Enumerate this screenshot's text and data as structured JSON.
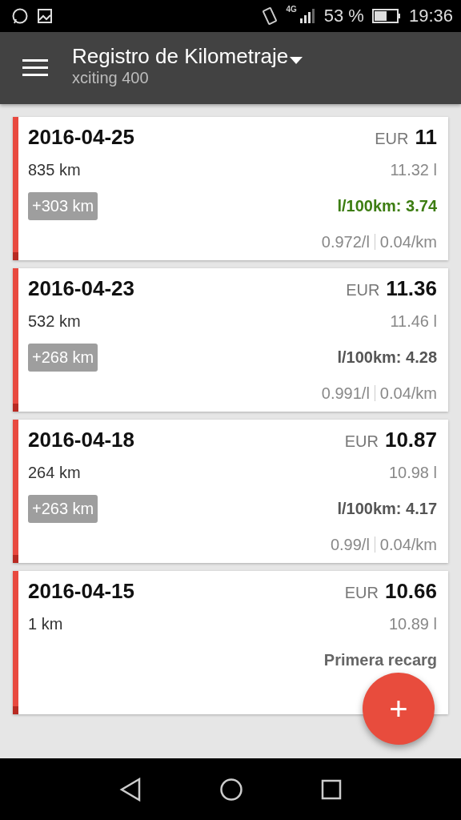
{
  "status_bar": {
    "battery": "53 %",
    "time": "19:36",
    "network": "4G"
  },
  "toolbar": {
    "title": "Registro de Kilometraje",
    "subtitle": "xciting 400"
  },
  "entries": [
    {
      "date": "2016-04-25",
      "currency": "EUR",
      "amount": "11",
      "odometer": "835 km",
      "liters": "11.32 l",
      "distance": "+303 km",
      "efficiency": "l/100km: 3.74",
      "color": "#3d7d12",
      "price_per_liter": "0.972/l",
      "cost_per_km": "0.04/km"
    },
    {
      "date": "2016-04-23",
      "currency": "EUR",
      "amount": "11.36",
      "odometer": "532 km",
      "liters": "11.46 l",
      "distance": "+268 km",
      "efficiency": "l/100km: 4.28",
      "color": "#555555",
      "price_per_liter": "0.991/l",
      "cost_per_km": "0.04/km"
    },
    {
      "date": "2016-04-18",
      "currency": "EUR",
      "amount": "10.87",
      "odometer": "264 km",
      "liters": "10.98 l",
      "distance": "+263 km",
      "efficiency": "l/100km: 4.17",
      "color": "#555555",
      "price_per_liter": "0.99/l",
      "cost_per_km": "0.04/km"
    },
    {
      "date": "2016-04-15",
      "currency": "EUR",
      "amount": "10.66",
      "odometer": "1 km",
      "liters": "10.89 l",
      "note": "Primera recarg"
    }
  ],
  "fab": {
    "label": "+"
  }
}
